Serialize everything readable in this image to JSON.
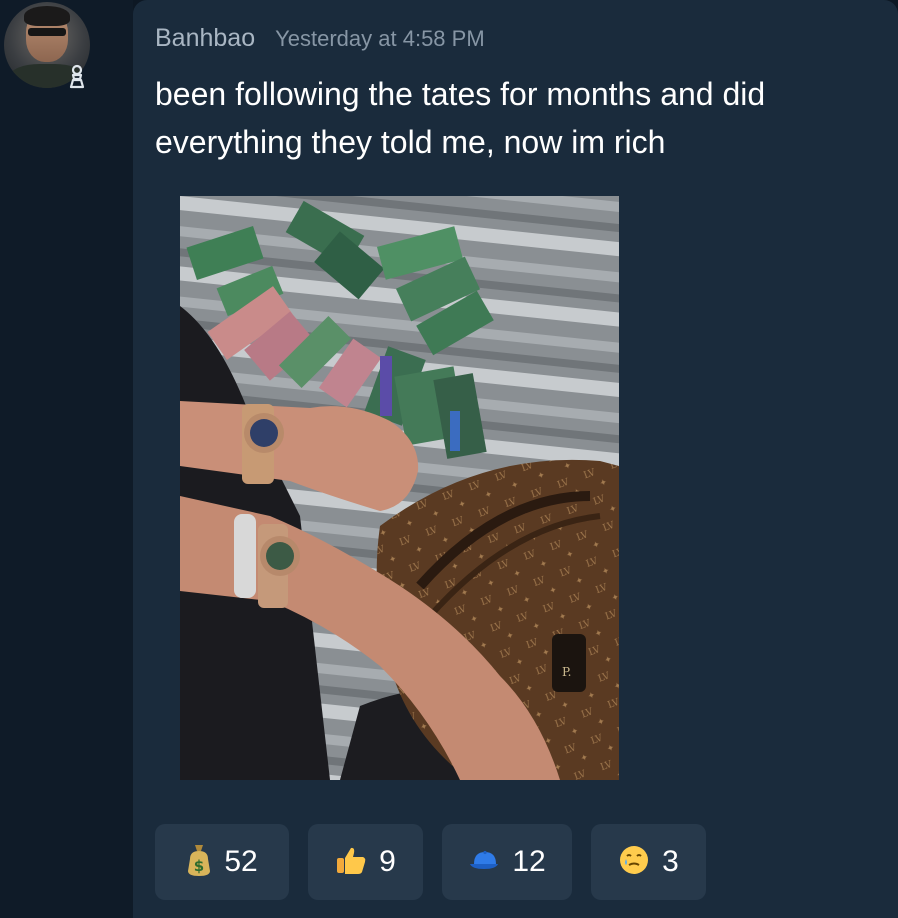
{
  "message": {
    "author": "Banhbao",
    "timestamp": "Yesterday at 4:58 PM",
    "text": "been following the tates for months and did everything they told me, now im rich",
    "avatar_icon": "user-avatar",
    "role_icon": "pawn-role-icon",
    "attachment": {
      "type": "photo",
      "visible_tag_text": "P."
    }
  },
  "reactions": [
    {
      "icon": "money-bag-icon",
      "count": "52"
    },
    {
      "icon": "thumbs-up-icon",
      "count": "9"
    },
    {
      "icon": "blue-cap-icon",
      "count": "12"
    },
    {
      "icon": "tear-smile-icon",
      "count": "3"
    }
  ],
  "colors": {
    "background": "#0d1824",
    "card": "#1a2b3c",
    "reaction_bg": "#27394b",
    "author": "#a9b6c3",
    "timestamp": "#8796a5",
    "text": "#ffffff"
  }
}
